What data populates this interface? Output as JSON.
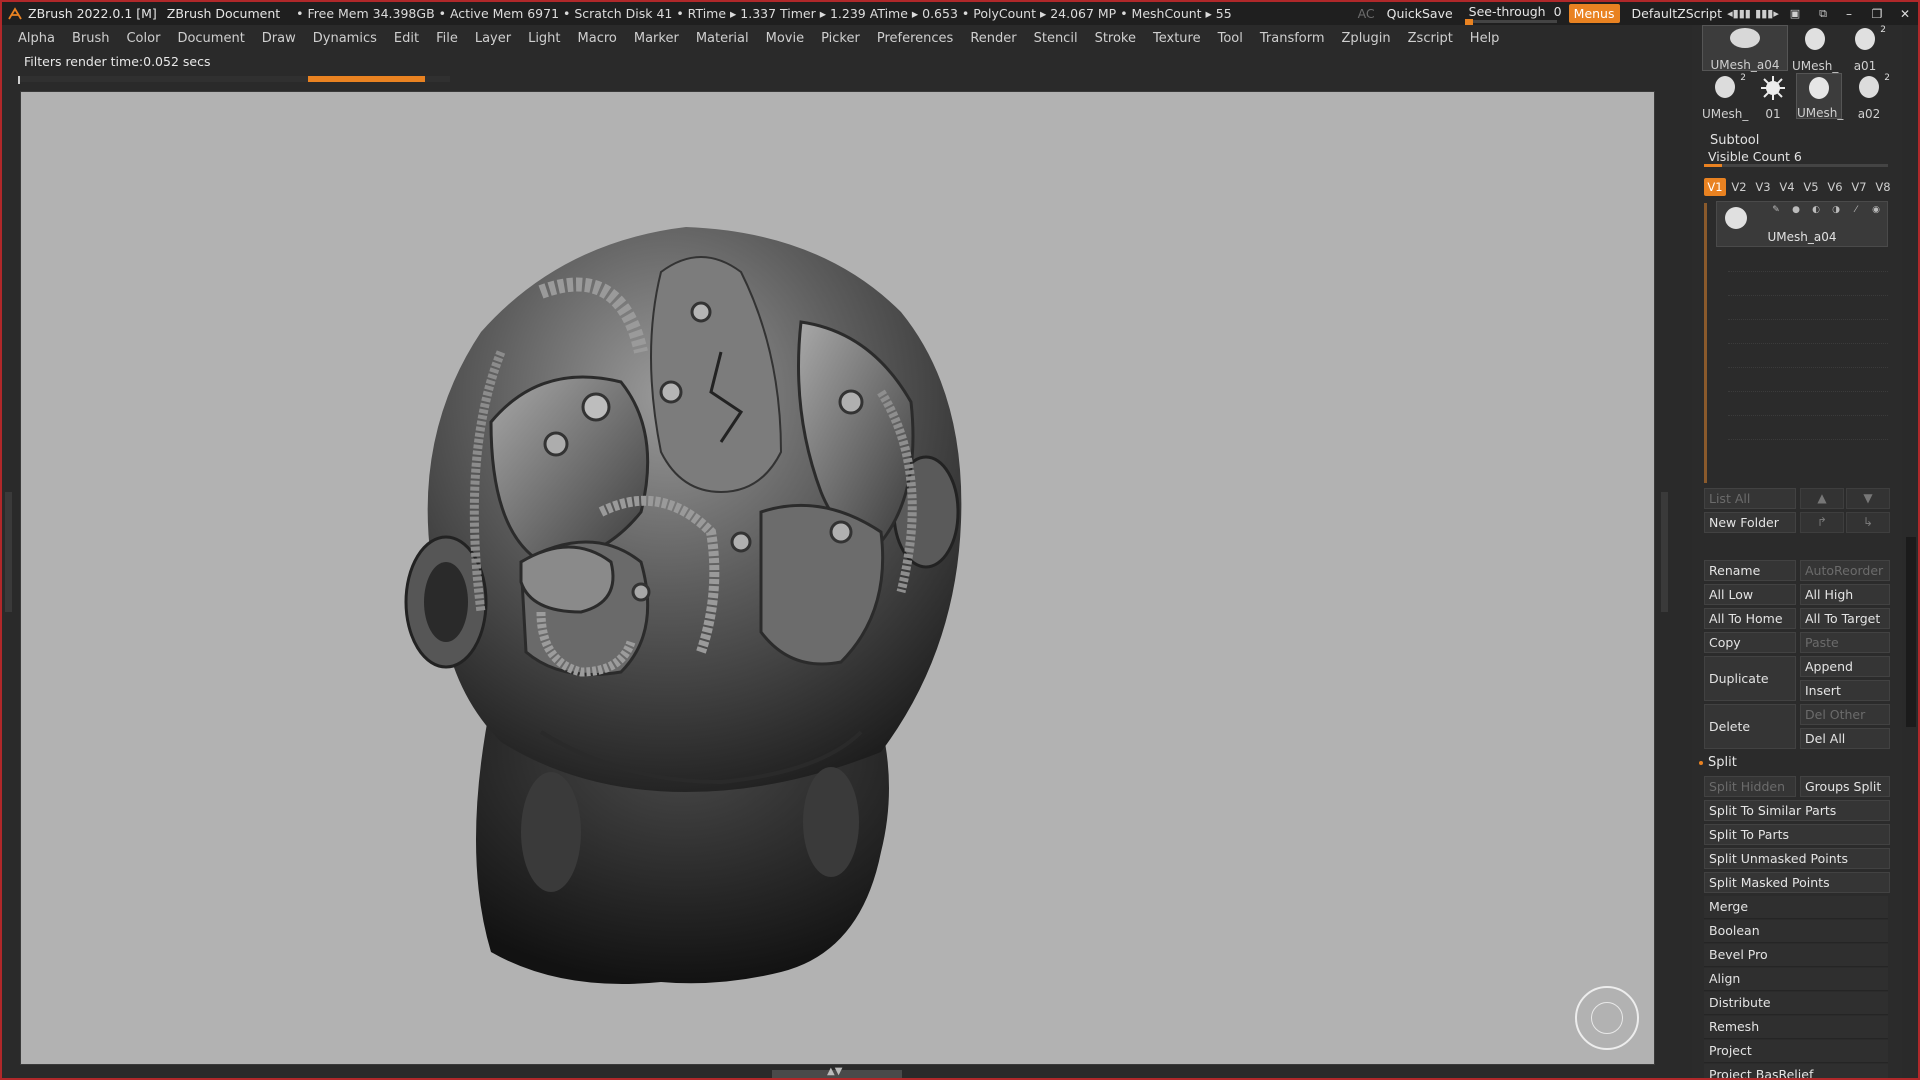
{
  "app": {
    "title": "ZBrush 2022.0.1 [M]",
    "document": "ZBrush Document",
    "stats": "• Free Mem 34.398GB • Active Mem 6971 • Scratch Disk 41 •  RTime ▸ 1.337 Timer ▸ 1.239 ATime ▸ 0.653 • PolyCount ▸ 24.067 MP  • MeshCount ▸ 55"
  },
  "titlebar_right": {
    "ac": "AC",
    "quicksave": "QuickSave",
    "seethrough_label": "See-through",
    "seethrough_value": "0",
    "menus": "Menus",
    "script": "DefaultZScript"
  },
  "menus": [
    "Alpha",
    "Brush",
    "Color",
    "Document",
    "Draw",
    "Dynamics",
    "Edit",
    "File",
    "Layer",
    "Light",
    "Macro",
    "Marker",
    "Material",
    "Movie",
    "Picker",
    "Preferences",
    "Render",
    "Stencil",
    "Stroke",
    "Texture",
    "Tool",
    "Transform",
    "Zplugin",
    "Zscript",
    "Help"
  ],
  "status_text": "Filters render time:0.052 secs",
  "progress_fraction": 0.27,
  "tray": {
    "thumbs": [
      {
        "label": "UMesh_a04",
        "num": ""
      },
      {
        "label": "UMesh_",
        "num": ""
      },
      {
        "label": "a01",
        "num": "2"
      },
      {
        "label": "UMesh_",
        "num": "2"
      },
      {
        "label": "01",
        "num": ""
      },
      {
        "label": "UMesh_",
        "num": ""
      },
      {
        "label": "a02",
        "num": "2"
      }
    ],
    "subtool_header": "Subtool",
    "visible_count_label": "Visible Count 6",
    "visible_count_fraction": 0.1,
    "vtabs": [
      "V1",
      "V2",
      "V3",
      "V4",
      "V5",
      "V6",
      "V7",
      "V8"
    ],
    "subtool_item": "UMesh_a04",
    "list_all": "List All",
    "new_folder": "New Folder",
    "buttons": {
      "rename": "Rename",
      "autoreorder": "AutoReorder",
      "all_low": "All Low",
      "all_high": "All High",
      "all_to_home": "All To Home",
      "all_to_target": "All To Target",
      "copy": "Copy",
      "paste": "Paste",
      "duplicate": "Duplicate",
      "append": "Append",
      "insert": "Insert",
      "delete": "Delete",
      "del_other": "Del Other",
      "del_all": "Del All"
    },
    "split": {
      "header": "Split",
      "split_hidden": "Split Hidden",
      "groups_split": "Groups Split",
      "similar": "Split To Similar Parts",
      "parts": "Split To Parts",
      "unmasked": "Split Unmasked Points",
      "masked": "Split Masked Points"
    },
    "sections": [
      "Merge",
      "Boolean",
      "Bevel Pro",
      "Align",
      "Distribute",
      "Remesh",
      "Project",
      "Project BasRelief"
    ]
  },
  "colors": {
    "accent": "#e98221",
    "frame": "#b0282a",
    "viewport_bg": "#b2b2b2"
  }
}
